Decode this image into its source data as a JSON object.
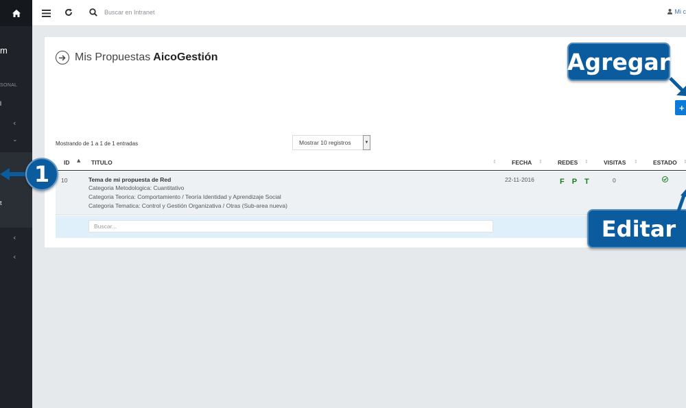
{
  "topbar": {
    "search_placeholder": "Buscar en Intranet",
    "user_label": "Mi c"
  },
  "sidebar": {
    "brand_fragment": "m",
    "section_label": "SONAL",
    "item_fragment_1": "l",
    "item_fragment_2": "t"
  },
  "panel": {
    "title_light": "Mis Propuestas",
    "title_bold": "AicoGestión",
    "add_button_label": "+",
    "info": "Mostrando de 1 a 1 de 1 entradas",
    "length_select": "Mostrar 10 registros"
  },
  "table": {
    "columns": {
      "id": "ID",
      "titulo": "TITULO",
      "fecha": "FECHA",
      "redes": "REDES",
      "visitas": "VISITAS",
      "estado": "ESTADO"
    },
    "rows": [
      {
        "id": "10",
        "title": "Tema de mi propuesta de Red",
        "line1": "Categoria Metodologica: Cuantitativo",
        "line2": "Categoria Teorica: Comportamiento / Teoría Identidad y Aprendizaje Social",
        "line3": "Categoria Tematica: Control y Gestión Organizativa / Otras (Sub-area nueva)",
        "fecha": "22-11-2016",
        "redes": "F P T",
        "visitas": "0"
      }
    ],
    "filter_placeholder": "Buscar..."
  },
  "callouts": {
    "agregar": "Agregar",
    "editar": "Editar",
    "step": "1"
  },
  "colors": {
    "sidebar": "#1f2329",
    "callout": "#0a5c9e",
    "add_button": "#0a7bd8",
    "status_green": "#1b7a1b",
    "filter_row": "#dff0fa"
  }
}
